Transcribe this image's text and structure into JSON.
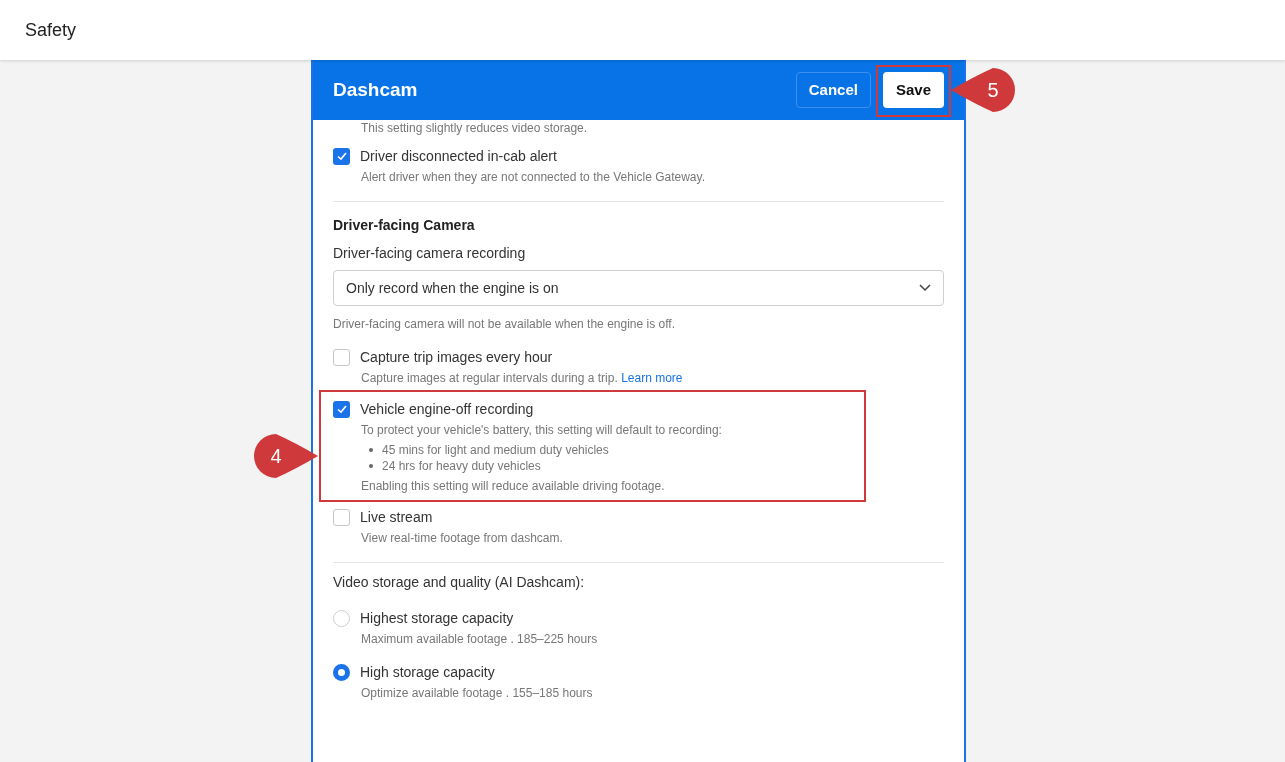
{
  "page_title": "Safety",
  "dialog": {
    "title": "Dashcam",
    "cancel": "Cancel",
    "save": "Save",
    "save_callout": "5",
    "clipped_note": "This setting slightly reduces video storage.",
    "items": [
      {
        "kind": "checkbox",
        "label": "Driver disconnected in-cab alert",
        "description": "Alert driver when they are not connected to the Vehicle Gateway.",
        "checked": true
      },
      {
        "kind": "divider"
      },
      {
        "kind": "heading",
        "label": "Driver-facing Camera"
      },
      {
        "kind": "select",
        "label": "Driver-facing camera recording",
        "value": "Only record when the engine is on",
        "description": "Driver-facing camera will not be available when the engine is off."
      },
      {
        "kind": "checkbox",
        "label": "Capture trip images every hour",
        "description": "Capture images at regular intervals during a trip.",
        "link": "Learn more",
        "checked": false
      },
      {
        "kind": "checkbox",
        "label": "Vehicle engine-off recording",
        "description": "To protect your vehicle's battery, this setting will default to recording:",
        "bullets": [
          "45 mins for light and medium duty vehicles",
          "24 hrs for heavy duty vehicles"
        ],
        "note": "Enabling this setting will reduce available driving footage.",
        "checked": true,
        "callout": "4"
      },
      {
        "kind": "checkbox",
        "label": "Live stream",
        "description": "View real-time footage from dashcam.",
        "checked": false
      },
      {
        "kind": "divider"
      },
      {
        "kind": "label",
        "label": "Video storage and quality (AI Dashcam):"
      },
      {
        "kind": "radio",
        "label": "Highest storage capacity",
        "description": "Maximum available footage . 185–225 hours",
        "selected": false
      },
      {
        "kind": "radio",
        "label": "High storage capacity",
        "description": "Optimize available footage . 155–185 hours",
        "selected": true
      }
    ]
  }
}
